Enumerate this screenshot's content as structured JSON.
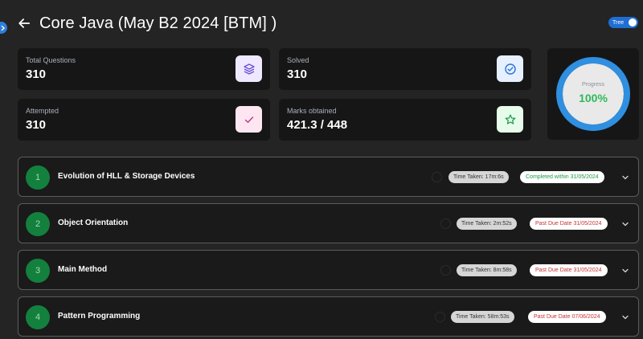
{
  "header": {
    "title": "Core Java (May B2 2024 [BTM] )"
  },
  "toggle": {
    "label": "Tree",
    "on": true
  },
  "stats": {
    "total_questions": {
      "label": "Total Questions",
      "value": "310"
    },
    "solved": {
      "label": "Solved",
      "value": "310"
    },
    "attempted": {
      "label": "Attempted",
      "value": "310"
    },
    "marks": {
      "label": "Marks obtained",
      "value": "421.3 / 448"
    }
  },
  "progress": {
    "label": "Progress",
    "value": "100%",
    "fraction": 1.0
  },
  "modules": [
    {
      "number": "1",
      "name": "Evolution of HLL & Storage Devices",
      "time": "Time Taken: 17m:6s",
      "status": "Completed within 31/05/2024",
      "status_type": "completed"
    },
    {
      "number": "2",
      "name": "Object Orientation",
      "time": "Time Taken: 2m:52s",
      "status": "Past Due Date 31/05/2024",
      "status_type": "past_due"
    },
    {
      "number": "3",
      "name": "Main Method",
      "time": "Time Taken: 8m:58s",
      "status": "Past Due Date 31/05/2024",
      "status_type": "past_due"
    },
    {
      "number": "4",
      "name": "Pattern Programming",
      "time": "Time Taken: 58m:53s",
      "status": "Past Due Date 07/06/2024",
      "status_type": "past_due"
    }
  ],
  "colors": {
    "accent": "#1f6ed4",
    "completed": "#1e9a47",
    "past_due": "#c83232",
    "module_badge": "#14803d"
  },
  "icons": {
    "total_questions": "layers-icon",
    "solved": "check-circle-icon",
    "attempted": "check-icon",
    "marks": "star-icon"
  }
}
